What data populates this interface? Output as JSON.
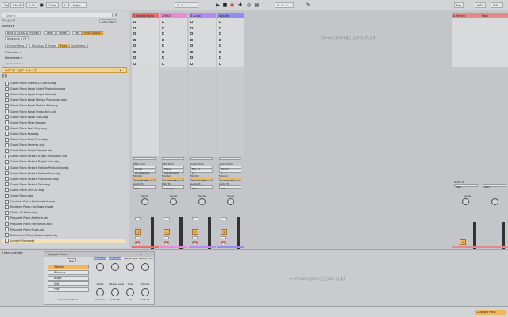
{
  "transport": {
    "tap": "Tap",
    "tempo": "130.00",
    "sig": "4 / 4",
    "bar": "1 Bar",
    "key": "Major",
    "position": "1 . 1 . 1",
    "loop_end": "4 . 0 . 0",
    "key_btn": "Key",
    "midi_btn": "MIDI",
    "cpu": "0 %"
  },
  "browser": {
    "search_placeholder": "Search",
    "tab_label": "アームシラ",
    "auto_tags_label": "Auto Tags",
    "sounds_label": "Sounds ▾",
    "sounds_pills": [
      "Bass",
      "Guitar & Plucked",
      "Lead",
      "Mallets",
      "Pad",
      "Piano & Keys"
    ],
    "selected_sound": "Piano & Keys",
    "sound_pill2": "Ambience & FX",
    "subcat_pills": [
      "Electric Piano",
      "Mini Keys",
      "Organ",
      "Piano",
      "Synth Keys"
    ],
    "selected_subcat": "Piano",
    "character_label": "Character ▾",
    "genre_label": "Wavetable ▾",
    "synth_label": "Synthesizer ▾",
    "filter_tag": "サウンド：ピアノ&キーズ",
    "name_header": "名前",
    "files": [
      "Grand Piano Classic LA Stand.adg",
      "Grand Piano Equal Bright Production.adg",
      "Grand Piano Equal Bright Solo.adg",
      "Grand Piano Equal Mellow Production.adg",
      "Grand Piano Equal Mellow Solo.adg",
      "Grand Piano Equal Production.adg",
      "Grand Piano Equal Solo.adg",
      "Grand Piano Filter Arp.adg",
      "Grand Piano Lost Vinyl.adg",
      "Grand Piano Pad.adg",
      "Grand Piano Pads Time.adg",
      "Grand Piano Reverse.adg",
      "Grand Piano Single Sample.adv",
      "Grand Piano Stretch Bright Production.adg",
      "Grand Piano Stretch Bright Solo.adg",
      "Grand Piano Stretch Mellow Production.adg",
      "Grand Piano Stretch Mellow Solo.adg",
      "Grand Piano Stretch Production.adg",
      "Grand Piano Stretch Solo.adg",
      "Grand Piano Thin Air.adg",
      "Grand Piano.adg",
      "Hyperion Piano (Automated).adg",
      "Kinetone Piano (Arcflowerz).adg",
      "Mister FX Piano.adg",
      "Prepared Piano Ambient.adv",
      "Prepared Piano Harmonics.adv",
      "Prepared Piano Muse.adv",
      "Reflections Piano (Automated).adg",
      "Upright Piano.adg"
    ],
    "selected_file": "Upright Piano.adg"
  },
  "tracks": [
    {
      "name": "1 Upright Piano",
      "color": "#e66f6f",
      "num": "1",
      "input_from": "All Ins",
      "channel": "All Channels",
      "monitor": "In Auto Off",
      "audio_to": "Main"
    },
    {
      "name": "2 MIDI",
      "color": "#e78bd3",
      "num": "2",
      "input_from": "All Ins",
      "channel": "All Channels",
      "monitor": "In Auto Off",
      "audio_to": "No Output"
    },
    {
      "name": "3 Audio",
      "color": "#b38cf1",
      "num": "3",
      "input_from": "Ext. In",
      "channel": "1",
      "monitor": "In Auto Off",
      "audio_to": "Main"
    },
    {
      "name": "4 Audio",
      "color": "#8e8ef1",
      "num": "4",
      "input_from": "Ext. In",
      "channel": "2",
      "monitor": "In Auto Off",
      "audio_to": "Main"
    }
  ],
  "returns": [
    {
      "name": "A Reverb",
      "color": "#e48a8a"
    },
    {
      "name": "Main",
      "color": "#e48a8a"
    }
  ],
  "labels": {
    "midi_from": "MIDI From",
    "audio_from": "Audio From",
    "monitor": "Monitor",
    "audio_to": "Audio To",
    "midi_to": "MIDI To",
    "sends": "Sends",
    "drop_hint": "ファイルとデバイスをここにドロップします",
    "drop_hint_bottom": "オーディオエフェクトをここにドロップします",
    "none_selected": "1 Item selected",
    "bottom_track": "1-Upright Piano"
  },
  "device": {
    "rack_name": "Upright Piano",
    "new_btn": "New",
    "variation_label": "Macro Variations",
    "chains": [
      "Trémolo",
      "Balances",
      "Bright",
      "Soft",
      "Post"
    ],
    "macros_top": [
      {
        "label": "Velocity Color",
        "value": ""
      },
      {
        "label": "Hammer Noise",
        "value": ""
      },
      {
        "label": "Reverb Size",
        "value": ""
      },
      {
        "label": "Reverb Time",
        "value": ""
      }
    ],
    "macros_bottom": [
      {
        "label": "Attack",
        "value": "0.00 ms"
      },
      {
        "label": "Release Level",
        "value": "0.00 dB"
      },
      {
        "label": "Tone",
        "value": "57"
      },
      {
        "label": "Volume",
        "value": "0.00 dB"
      }
    ]
  },
  "colors": {
    "accent": "#f0b75c",
    "record": "#d65a4a"
  }
}
